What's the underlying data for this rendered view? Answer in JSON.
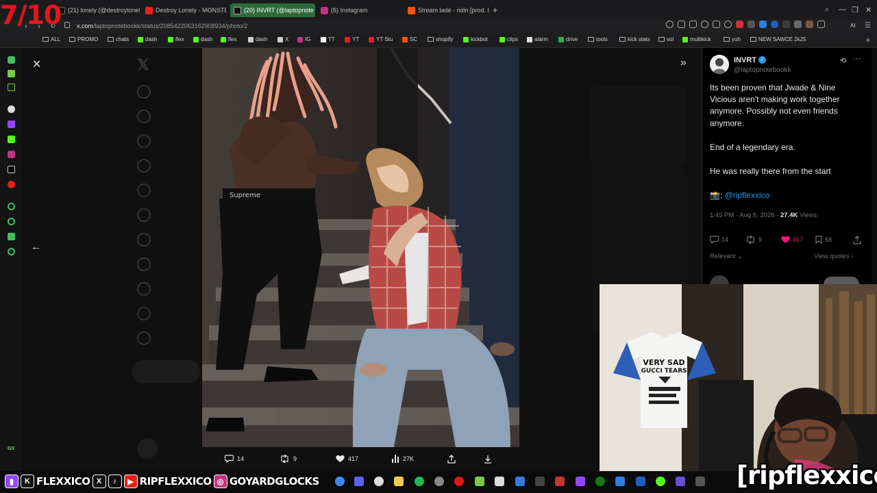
{
  "overlay_score": "7/10",
  "browser": {
    "tabs": [
      {
        "label": "(21) lonely (@destroylonely",
        "active": false
      },
      {
        "label": "Destroy Lonely - MONSTE",
        "active": false
      },
      {
        "label": "(20) INVRT (@laptopnote",
        "active": true
      },
      {
        "label": "(6) Instagram",
        "active": false
      },
      {
        "label": "Stream ladé - ridin [prod. h",
        "active": false
      }
    ],
    "new_tab": "+",
    "url_host": "x.com",
    "url_path": "/laptopnotebookk/status/2085422063162908934/photo/2",
    "ai_label": "AI",
    "bookmarks": [
      {
        "label": "ALL",
        "kind": "folder"
      },
      {
        "label": "PROMO",
        "kind": "folder"
      },
      {
        "label": "chats",
        "kind": "folder"
      },
      {
        "label": "dash",
        "kind": "kick"
      },
      {
        "label": "flex",
        "kind": "kick"
      },
      {
        "label": "dash",
        "kind": "kick"
      },
      {
        "label": "flex",
        "kind": "kick"
      },
      {
        "label": "dash",
        "kind": "x"
      },
      {
        "label": "X",
        "kind": "x"
      },
      {
        "label": "IG",
        "kind": "ig"
      },
      {
        "label": "TT",
        "kind": "tt"
      },
      {
        "label": "YT",
        "kind": "yt"
      },
      {
        "label": "YT Stu",
        "kind": "yt"
      },
      {
        "label": "SC",
        "kind": "sc"
      },
      {
        "label": "shopify",
        "kind": "folder"
      },
      {
        "label": "kickbot",
        "kind": "kick"
      },
      {
        "label": "clips",
        "kind": "kick"
      },
      {
        "label": "alarm",
        "kind": "alarm"
      },
      {
        "label": "drive",
        "kind": "drive"
      },
      {
        "label": "tools",
        "kind": "folder"
      },
      {
        "label": "kick stats",
        "kind": "folder"
      },
      {
        "label": "sol",
        "kind": "folder"
      },
      {
        "label": "multikick",
        "kind": "kick"
      },
      {
        "label": "yuh",
        "kind": "folder"
      },
      {
        "label": "NEW SAWCE 2k25",
        "kind": "folder"
      }
    ]
  },
  "sidebar_gx": "GX",
  "tweet": {
    "display_name": "INVRT",
    "handle": "@laptopnotebookk",
    "lines": [
      "Its been proven that Jwade & Nine",
      "Vicious aren't making work together",
      "anymore. Possibly not even friends",
      "anymore.",
      "End of a legendary era.",
      "He was really there from the start"
    ],
    "mention_prefix": "📸:",
    "mention": "@ripflexxico",
    "time": "1:45 PM · Aug 6, 2026 ·",
    "views_count": "27.4K",
    "views_label": "Views",
    "replies": "14",
    "reposts": "9",
    "likes": "417",
    "bookmarks": "68",
    "sort_label": "Relevant",
    "view_quotes": "View quotes"
  },
  "media_actions": {
    "replies": "14",
    "reposts": "9",
    "likes": "417",
    "views": "27K"
  },
  "webcam": {
    "shirt_line1": "VERY SAD",
    "shirt_line2": "GUCCI TEARS"
  },
  "socials": [
    {
      "icon": "twitch-icon",
      "glyph": "▮",
      "handle": ""
    },
    {
      "icon": "kick-icon",
      "glyph": "K",
      "handle": "FLEXXICO"
    },
    {
      "icon": "x-icon",
      "glyph": "X",
      "handle": ""
    },
    {
      "icon": "tiktok-icon",
      "glyph": "♪",
      "handle": ""
    },
    {
      "icon": "youtube-icon",
      "glyph": "▶",
      "handle": "RIPFLEXXICO"
    },
    {
      "icon": "instagram-icon",
      "glyph": "◎",
      "handle": "GOYARDGLOCKS"
    }
  ],
  "brand_overlay": "[ripflexxico]",
  "colors": {
    "score_red": "#e5151b",
    "active_tab": "#2e6b3c",
    "like_pink": "#f91880",
    "link_blue": "#1d9bf0"
  }
}
